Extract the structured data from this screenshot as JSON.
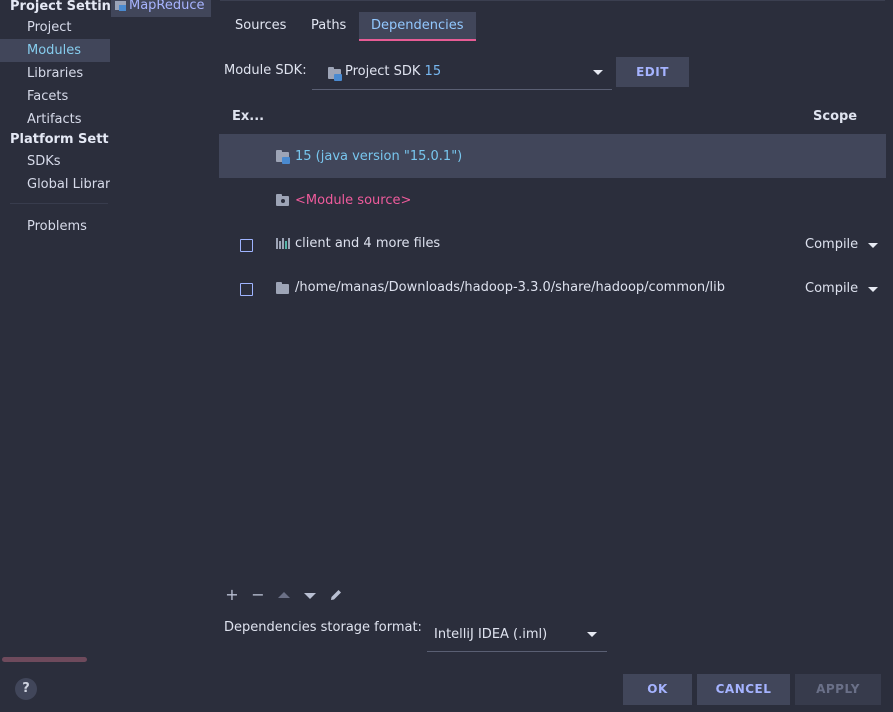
{
  "sidebar": {
    "project_settings_header": "Project Settin",
    "project_items": [
      {
        "label": "Project",
        "selected": false
      },
      {
        "label": "Modules",
        "selected": true
      },
      {
        "label": "Libraries",
        "selected": false
      },
      {
        "label": "Facets",
        "selected": false
      },
      {
        "label": "Artifacts",
        "selected": false
      }
    ],
    "platform_settings_header": "Platform Sett",
    "platform_items": [
      {
        "label": "SDKs"
      },
      {
        "label": "Global Librar"
      }
    ],
    "problems_label": "Problems",
    "help_label": "?"
  },
  "module": {
    "name": "MapReduce"
  },
  "tabs": [
    {
      "label": "Sources",
      "selected": false
    },
    {
      "label": "Paths",
      "selected": false
    },
    {
      "label": "Dependencies",
      "selected": true
    }
  ],
  "sdk": {
    "label": "Module SDK:",
    "value_name": "Project SDK",
    "value_version": "15",
    "edit_label": "EDIT"
  },
  "table": {
    "col_export": "Ex...",
    "col_scope": "Scope",
    "rows": [
      {
        "icon": "jdk-folder-icon",
        "name": "15 (java version \"15.0.1\")",
        "checkbox": false,
        "scope": "",
        "color": "#78c6ee"
      },
      {
        "icon": "source-folder-icon",
        "name": "<Module source>",
        "checkbox": false,
        "scope": "",
        "color": "#ef5b9c"
      },
      {
        "icon": "library-icon",
        "name": "client and 4 more files",
        "checkbox": true,
        "scope": "Compile",
        "color": "#dde1ee"
      },
      {
        "icon": "folder-icon",
        "name": "/home/manas/Downloads/hadoop-3.3.0/share/hadoop/common/lib",
        "checkbox": true,
        "scope": "Compile",
        "color": "#dde1ee"
      }
    ]
  },
  "toolbar": {
    "add": "+",
    "remove": "−"
  },
  "storage": {
    "label": "Dependencies storage format:",
    "value": "IntelliJ IDEA (.iml)"
  },
  "buttons": {
    "ok": "OK",
    "cancel": "CANCEL",
    "apply": "APPLY"
  },
  "colors": {
    "background": "#2b2e3c",
    "selection": "#41465a",
    "accent_pink": "#e75c95",
    "link_blue": "#a5b3ff"
  }
}
